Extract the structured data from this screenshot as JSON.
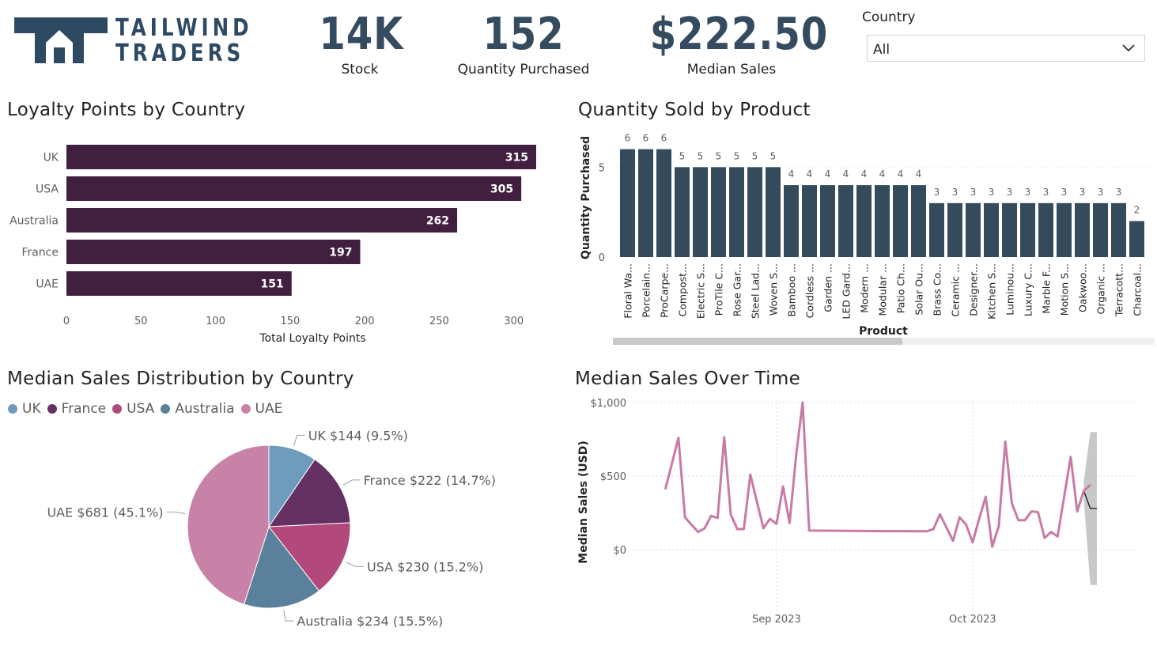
{
  "brand": {
    "line1": "TAILWIND",
    "line2": "TRADERS",
    "color": "#2e4a63"
  },
  "kpis": [
    {
      "value": "14K",
      "label": "Stock"
    },
    {
      "value": "152",
      "label": "Quantity Purchased"
    },
    {
      "value": "$222.50",
      "label": "Median Sales"
    }
  ],
  "slicer": {
    "title": "Country",
    "value": "All",
    "icon": "chevron-down-icon"
  },
  "titles": {
    "loyalty": "Loyalty Points by Country",
    "quantity": "Quantity Sold by Product",
    "pie": "Median Sales Distribution by Country",
    "line": "Median Sales Over Time"
  },
  "chart_data": [
    {
      "id": "loyalty",
      "type": "bar",
      "orientation": "horizontal",
      "categories": [
        "UK",
        "USA",
        "Australia",
        "France",
        "UAE"
      ],
      "values": [
        315,
        305,
        262,
        197,
        151
      ],
      "xlabel": "Total Loyalty Points",
      "xticks": [
        0,
        50,
        100,
        150,
        200,
        250,
        300
      ],
      "xlim": [
        0,
        315
      ],
      "color": "#41203f",
      "data_labels": true
    },
    {
      "id": "quantity",
      "type": "bar",
      "orientation": "vertical",
      "categories": [
        "Floral Wa...",
        "Porcelain...",
        "ProCarpe...",
        "Compost...",
        "Electric S...",
        "ProTile C...",
        "Rose Gar...",
        "Steel Lad...",
        "Woven S...",
        "Bamboo ...",
        "Cordless ...",
        "Garden ...",
        "LED Gard...",
        "Modern ...",
        "Modular ...",
        "Patio Ch...",
        "Solar Ou...",
        "Brass Co...",
        "Ceramic ...",
        "Designer...",
        "Kitchen S...",
        "Luminou...",
        "Luxury C...",
        "Marble F...",
        "Motion S...",
        "Oakwoo...",
        "Organic ...",
        "Terracott...",
        "Charcoal..."
      ],
      "values": [
        6,
        6,
        6,
        5,
        5,
        5,
        5,
        5,
        5,
        4,
        4,
        4,
        4,
        4,
        4,
        4,
        4,
        3,
        3,
        3,
        3,
        3,
        3,
        3,
        3,
        3,
        3,
        3,
        2
      ],
      "xlabel": "Product",
      "ylabel": "Quantity Purchased",
      "yticks": [
        0,
        5
      ],
      "ylim": [
        0,
        6.6
      ],
      "color": "#344b5c",
      "data_labels": true
    },
    {
      "id": "pie",
      "type": "pie",
      "legend_position": "top-left",
      "slices": [
        {
          "name": "UK",
          "value": 144,
          "label": "UK $144 (9.5%)",
          "color": "#6f9bbd"
        },
        {
          "name": "France",
          "value": 222,
          "label": "France $222 (14.7%)",
          "color": "#653162"
        },
        {
          "name": "USA",
          "value": 230,
          "label": "USA $230 (15.2%)",
          "color": "#b3487c"
        },
        {
          "name": "Australia",
          "value": 234,
          "label": "Australia $234 (15.5%)",
          "color": "#5a809b"
        },
        {
          "name": "UAE",
          "value": 681,
          "label": "UAE $681 (45.1%)",
          "color": "#c882a8"
        }
      ]
    },
    {
      "id": "line",
      "type": "line",
      "ylabel": "Median Sales (USD)",
      "yticks": [
        "$0",
        "$500",
        "$1,000"
      ],
      "ylim": [
        0,
        1000
      ],
      "x_ticks": [
        "Sep 2023",
        "Oct 2023"
      ],
      "x_tick_dates": [
        "2023-09-01",
        "2023-10-01"
      ],
      "color": "#c77ba5",
      "series": [
        {
          "points": [
            [
              "2023-08-15",
              410
            ],
            [
              "2023-08-17",
              760
            ],
            [
              "2023-08-18",
              220
            ],
            [
              "2023-08-20",
              120
            ],
            [
              "2023-08-21",
              145
            ],
            [
              "2023-08-22",
              230
            ],
            [
              "2023-08-23",
              215
            ],
            [
              "2023-08-24",
              765
            ],
            [
              "2023-08-25",
              240
            ],
            [
              "2023-08-26",
              140
            ],
            [
              "2023-08-27",
              140
            ],
            [
              "2023-08-28",
              510
            ],
            [
              "2023-08-30",
              145
            ],
            [
              "2023-08-31",
              210
            ],
            [
              "2023-09-01",
              175
            ],
            [
              "2023-09-02",
              430
            ],
            [
              "2023-09-03",
              180
            ],
            [
              "2023-09-04",
              640
            ],
            [
              "2023-09-05",
              1000
            ],
            [
              "2023-09-06",
              130
            ],
            [
              "2023-09-12",
              128
            ],
            [
              "2023-09-18",
              126
            ],
            [
              "2023-09-24",
              125
            ],
            [
              "2023-09-25",
              140
            ],
            [
              "2023-09-26",
              240
            ],
            [
              "2023-09-27",
              150
            ],
            [
              "2023-09-28",
              60
            ],
            [
              "2023-09-29",
              220
            ],
            [
              "2023-09-30",
              170
            ],
            [
              "2023-10-01",
              50
            ],
            [
              "2023-10-02",
              210
            ],
            [
              "2023-10-03",
              360
            ],
            [
              "2023-10-04",
              20
            ],
            [
              "2023-10-05",
              160
            ],
            [
              "2023-10-06",
              735
            ],
            [
              "2023-10-07",
              315
            ],
            [
              "2023-10-08",
              200
            ],
            [
              "2023-10-09",
              200
            ],
            [
              "2023-10-10",
              260
            ],
            [
              "2023-10-11",
              255
            ],
            [
              "2023-10-12",
              80
            ],
            [
              "2023-10-13",
              120
            ],
            [
              "2023-10-14",
              90
            ],
            [
              "2023-10-16",
              630
            ],
            [
              "2023-10-17",
              260
            ],
            [
              "2023-10-18",
              400
            ],
            [
              "2023-10-19",
              440
            ]
          ]
        }
      ],
      "forecast": {
        "color": "#000000",
        "band_color": "#c8c8c8",
        "points": [
          [
            "2023-10-18",
            400
          ],
          [
            "2023-10-19",
            280
          ],
          [
            "2023-10-20",
            280
          ]
        ],
        "upper": [
          [
            "2023-10-18",
            460
          ],
          [
            "2023-10-19",
            800
          ],
          [
            "2023-10-20",
            800
          ]
        ],
        "lower": [
          [
            "2023-10-18",
            340
          ],
          [
            "2023-10-19",
            -240
          ],
          [
            "2023-10-20",
            -240
          ]
        ]
      }
    }
  ]
}
